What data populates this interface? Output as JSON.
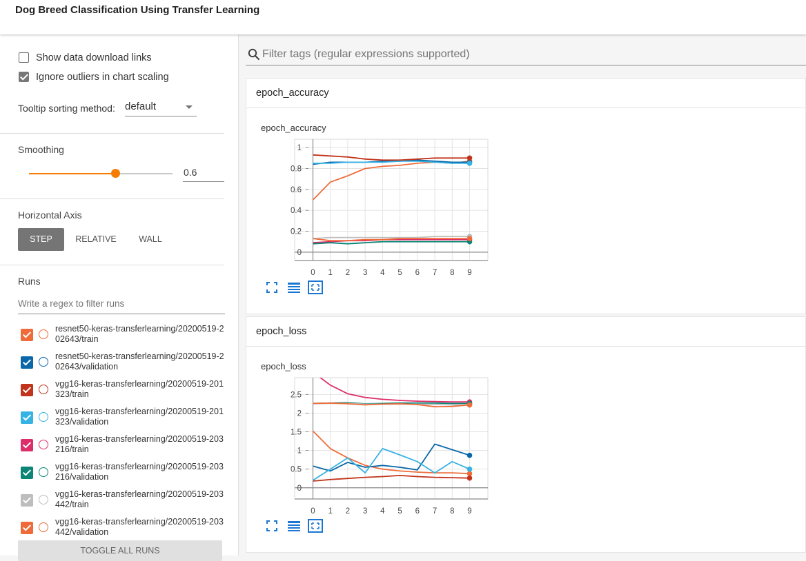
{
  "app": {
    "title": "Dog Breed Classification Using Transfer Learning"
  },
  "sidebar": {
    "show_download_links": {
      "label": "Show data download links",
      "checked": false
    },
    "ignore_outliers": {
      "label": "Ignore outliers in chart scaling",
      "checked": true
    },
    "tooltip_sort": {
      "label": "Tooltip sorting method:",
      "value": "default"
    },
    "smoothing": {
      "label": "Smoothing",
      "value": "0.6",
      "fraction": 0.6
    },
    "horizontal_axis": {
      "label": "Horizontal Axis",
      "options": [
        "STEP",
        "RELATIVE",
        "WALL"
      ],
      "selected": "STEP"
    },
    "runs": {
      "label": "Runs",
      "filter_placeholder": "Write a regex to filter runs",
      "items": [
        {
          "name": "resnet50-keras-transferlearning/20200519-202643/train",
          "color": "#ef6c3a",
          "checked": true
        },
        {
          "name": "resnet50-keras-transferlearning/20200519-202643/validation",
          "color": "#0a67a8",
          "checked": true
        },
        {
          "name": "vgg16-keras-transferlearning/20200519-201323/train",
          "color": "#c1341b",
          "checked": true
        },
        {
          "name": "vgg16-keras-transferlearning/20200519-201323/validation",
          "color": "#36b2e3",
          "checked": true
        },
        {
          "name": "vgg16-keras-transferlearning/20200519-203216/train",
          "color": "#dd2e6b",
          "checked": true
        },
        {
          "name": "vgg16-keras-transferlearning/20200519-203216/validation",
          "color": "#0c8576",
          "checked": true
        },
        {
          "name": "vgg16-keras-transferlearning/20200519-203442/train",
          "color": "#bdbdbd",
          "checked": true
        },
        {
          "name": "vgg16-keras-transferlearning/20200519-203442/validation",
          "color": "#ef6c3a",
          "checked": true
        }
      ],
      "toggle_all": "TOGGLE ALL RUNS"
    }
  },
  "main": {
    "filter_placeholder": "Filter tags (regular expressions supported)",
    "cards": [
      {
        "header": "epoch_accuracy",
        "chart_title": "epoch_accuracy"
      },
      {
        "header": "epoch_loss",
        "chart_title": "epoch_loss"
      }
    ]
  },
  "icons": [
    "search-icon",
    "fullscreen-icon",
    "data-table-icon",
    "fit-domain-icon"
  ],
  "chart_data": [
    {
      "type": "line",
      "title": "epoch_accuracy",
      "x": [
        0,
        1,
        2,
        3,
        4,
        5,
        6,
        7,
        8,
        9
      ],
      "xticks": [
        "0",
        "1",
        "2",
        "3",
        "4",
        "5",
        "6",
        "7",
        "8",
        "9"
      ],
      "yticks": [
        "0",
        "0.2",
        "0.4",
        "0.6",
        "0.8",
        "1"
      ],
      "ylim": [
        -0.08,
        1.08
      ],
      "xlim": [
        -1.05,
        10.05
      ],
      "grid": true,
      "series": [
        {
          "color": "#ef6c3a",
          "values": [
            0.5,
            0.67,
            0.73,
            0.8,
            0.82,
            0.83,
            0.85,
            0.86,
            0.85,
            0.87
          ]
        },
        {
          "color": "#0a67a8",
          "values": [
            0.84,
            0.86,
            0.86,
            0.86,
            0.87,
            0.87,
            0.88,
            0.87,
            0.86,
            0.86
          ]
        },
        {
          "color": "#c1341b",
          "values": [
            0.93,
            0.92,
            0.91,
            0.89,
            0.88,
            0.88,
            0.89,
            0.9,
            0.9,
            0.9
          ]
        },
        {
          "color": "#36b2e3",
          "values": [
            0.85,
            0.85,
            0.86,
            0.86,
            0.86,
            0.87,
            0.87,
            0.86,
            0.85,
            0.85
          ]
        },
        {
          "color": "#dd2e6b",
          "values": [
            0.09,
            0.1,
            0.11,
            0.11,
            0.12,
            0.12,
            0.12,
            0.12,
            0.12,
            0.12
          ]
        },
        {
          "color": "#0c8576",
          "values": [
            0.08,
            0.09,
            0.08,
            0.09,
            0.1,
            0.1,
            0.1,
            0.1,
            0.1,
            0.1
          ]
        },
        {
          "color": "#bdbdbd",
          "values": [
            0.13,
            0.14,
            0.14,
            0.14,
            0.14,
            0.14,
            0.14,
            0.15,
            0.15,
            0.15
          ]
        },
        {
          "color": "#ef6c3a",
          "values": [
            0.13,
            0.11,
            0.11,
            0.12,
            0.12,
            0.13,
            0.13,
            0.13,
            0.13,
            0.13
          ]
        }
      ]
    },
    {
      "type": "line",
      "title": "epoch_loss",
      "x": [
        0,
        1,
        2,
        3,
        4,
        5,
        6,
        7,
        8,
        9
      ],
      "xticks": [
        "0",
        "1",
        "2",
        "3",
        "4",
        "5",
        "6",
        "7",
        "8",
        "9"
      ],
      "yticks": [
        "0",
        "0.5",
        "1",
        "1.5",
        "2",
        "2.5"
      ],
      "ylim": [
        -0.3,
        2.95
      ],
      "xlim": [
        -1.05,
        10.05
      ],
      "grid": true,
      "series": [
        {
          "color": "#ef6c3a",
          "values": [
            1.52,
            1.05,
            0.8,
            0.6,
            0.5,
            0.45,
            0.42,
            0.4,
            0.4,
            0.38
          ]
        },
        {
          "color": "#0a67a8",
          "values": [
            0.58,
            0.45,
            0.68,
            0.55,
            0.6,
            0.55,
            0.48,
            1.17,
            1.02,
            0.87
          ]
        },
        {
          "color": "#c1341b",
          "values": [
            0.18,
            0.22,
            0.25,
            0.28,
            0.3,
            0.33,
            0.3,
            0.28,
            0.27,
            0.26
          ]
        },
        {
          "color": "#36b2e3",
          "values": [
            0.2,
            0.5,
            0.8,
            0.4,
            1.05,
            0.88,
            0.7,
            0.4,
            0.7,
            0.5
          ]
        },
        {
          "color": "#dd2e6b",
          "values": [
            3.1,
            2.75,
            2.52,
            2.42,
            2.37,
            2.34,
            2.32,
            2.31,
            2.3,
            2.3
          ]
        },
        {
          "color": "#0c8576",
          "values": [
            2.26,
            2.27,
            2.28,
            2.25,
            2.26,
            2.27,
            2.27,
            2.27,
            2.26,
            2.26
          ]
        },
        {
          "color": "#bdbdbd",
          "values": [
            2.25,
            2.26,
            2.26,
            2.24,
            2.24,
            2.24,
            2.24,
            2.23,
            2.22,
            2.22
          ]
        },
        {
          "color": "#ef6c3a",
          "values": [
            2.26,
            2.27,
            2.25,
            2.22,
            2.24,
            2.25,
            2.23,
            2.17,
            2.18,
            2.22
          ]
        }
      ]
    }
  ]
}
